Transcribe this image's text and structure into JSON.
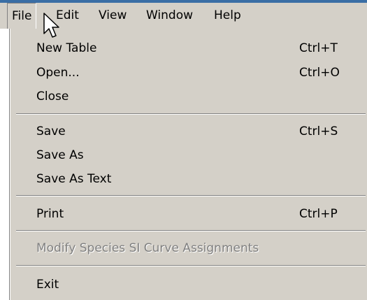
{
  "menubar": {
    "items": [
      {
        "label": "File"
      },
      {
        "label": "Edit"
      },
      {
        "label": "View"
      },
      {
        "label": "Window"
      },
      {
        "label": "Help"
      }
    ]
  },
  "file_menu": {
    "items": [
      {
        "label": "New Table",
        "shortcut": "Ctrl+T",
        "enabled": true
      },
      {
        "label": "Open...",
        "shortcut": "Ctrl+O",
        "enabled": true
      },
      {
        "label": "Close",
        "shortcut": "",
        "enabled": true
      },
      {
        "label": "Save",
        "shortcut": "Ctrl+S",
        "enabled": true
      },
      {
        "label": "Save As",
        "shortcut": "",
        "enabled": true
      },
      {
        "label": "Save As Text",
        "shortcut": "",
        "enabled": true
      },
      {
        "label": "Print",
        "shortcut": "Ctrl+P",
        "enabled": true
      },
      {
        "label": "Modify Species SI Curve Assignments",
        "shortcut": "",
        "enabled": false
      },
      {
        "label": "Exit",
        "shortcut": "",
        "enabled": true
      }
    ]
  },
  "icons": {
    "cursor": "arrow-cursor-icon"
  },
  "colors": {
    "menu_background": "#d4d0c8",
    "title_bar": "#3a6ea5",
    "disabled_text": "#808080"
  }
}
